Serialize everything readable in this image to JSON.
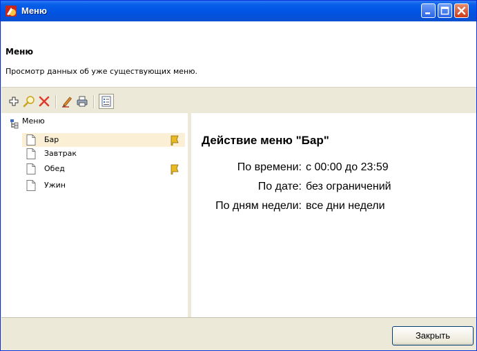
{
  "window": {
    "title": "Меню",
    "icons": {
      "app": "app-logo-icon",
      "minimize": "minimize-icon",
      "maximize": "maximize-icon",
      "close": "close-icon"
    }
  },
  "header": {
    "title": "Меню",
    "description": "Просмотр данных об уже существующих меню."
  },
  "toolbar": {
    "tools": [
      {
        "icon": "add-icon"
      },
      {
        "icon": "search-icon"
      },
      {
        "icon": "delete-icon"
      },
      {
        "icon": "edit-icon"
      },
      {
        "icon": "print-icon"
      },
      {
        "icon": "list-view-icon",
        "pressed": true
      }
    ]
  },
  "tree": {
    "root_label": "Меню",
    "items": [
      {
        "label": "Бар",
        "selected": true,
        "flag": true
      },
      {
        "label": "Завтрак",
        "selected": false,
        "flag": false
      },
      {
        "label": "Обед",
        "selected": false,
        "flag": true
      },
      {
        "label": "Ужин",
        "selected": false,
        "flag": false
      }
    ]
  },
  "detail": {
    "title": "Действие меню \"Бар\"",
    "rows": [
      {
        "label": "По времени:",
        "value": "с 00:00 до 23:59"
      },
      {
        "label": "По дате:",
        "value": "без ограничений"
      },
      {
        "label": "По дням недели:",
        "value": "все дни недели"
      }
    ]
  },
  "footer": {
    "close_label": "Закрыть"
  },
  "colors": {
    "title_bar": "#0054e3",
    "selection": "#fbefd6",
    "chrome": "#ece9d8",
    "delete": "#e03a2a"
  }
}
